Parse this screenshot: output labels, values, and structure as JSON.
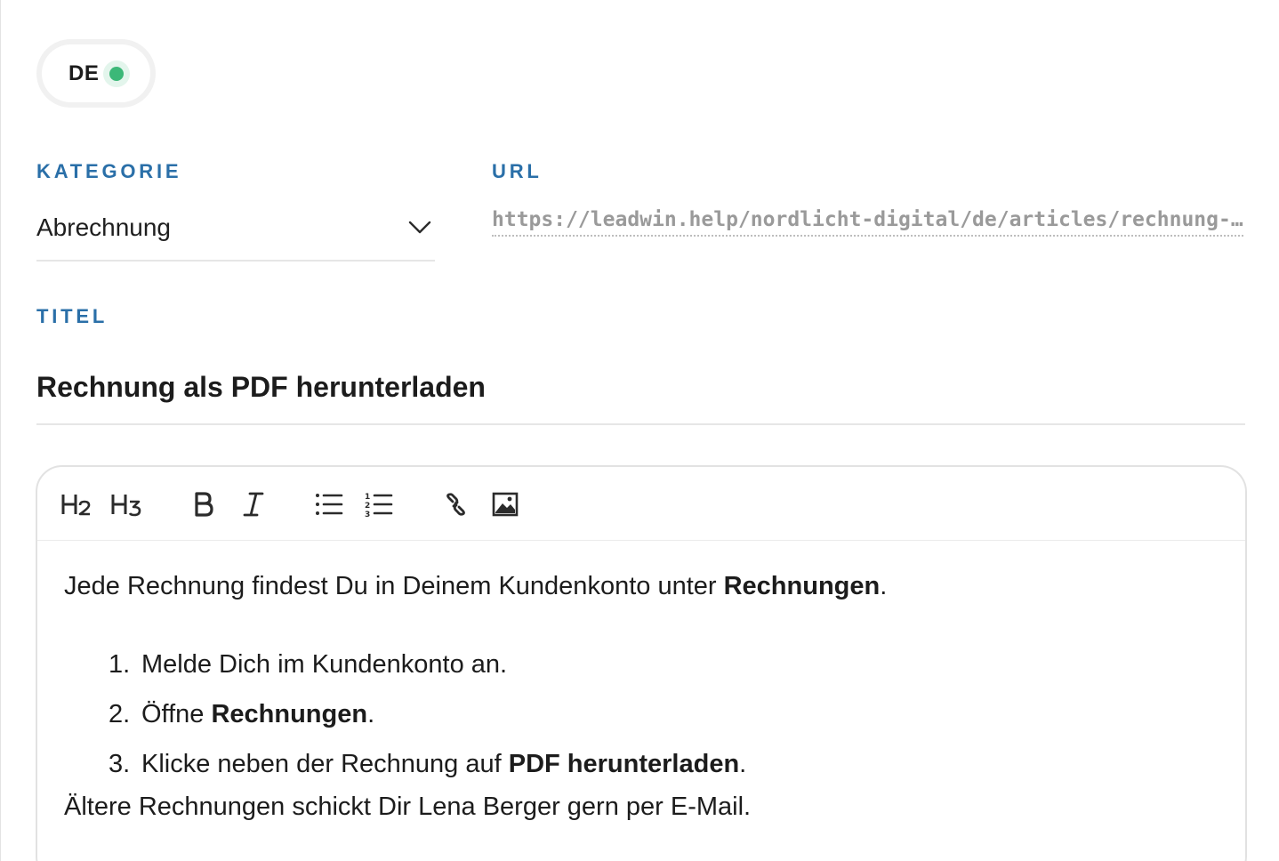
{
  "language": {
    "code": "DE",
    "status_color": "#3cb878"
  },
  "category": {
    "label": "KATEGORIE",
    "value": "Abrechnung"
  },
  "url": {
    "label": "URL",
    "value": "https://leadwin.help/nordlicht-digital/de/articles/rechnung-als-pdf-herunterladen"
  },
  "title": {
    "label": "TITEL",
    "value": "Rechnung als PDF herunterladen"
  },
  "toolbar": {
    "h2": "H2",
    "h3": "H3",
    "buttons": [
      "heading-2",
      "heading-3",
      "bold",
      "italic",
      "bullet-list",
      "ordered-list",
      "link",
      "image"
    ]
  },
  "content": {
    "intro_text": "Jede Rechnung findest Du in Deinem Kundenkonto unter ",
    "intro_bold": "Rechnungen",
    "intro_end": ".",
    "steps": [
      {
        "num": "1.",
        "text": "Melde Dich im Kundenkonto an.",
        "bold": "",
        "end": ""
      },
      {
        "num": "2.",
        "text": "Öffne ",
        "bold": "Rechnungen",
        "end": "."
      },
      {
        "num": "3.",
        "text": "Klicke neben der Rechnung auf ",
        "bold": "PDF herunterladen",
        "end": "."
      }
    ],
    "outro": "Ältere Rechnungen schickt Dir Lena Berger gern per E-Mail."
  },
  "colors": {
    "accent": "#2a6fa8",
    "muted": "#9a9a9a",
    "border": "#e2e2e2"
  }
}
